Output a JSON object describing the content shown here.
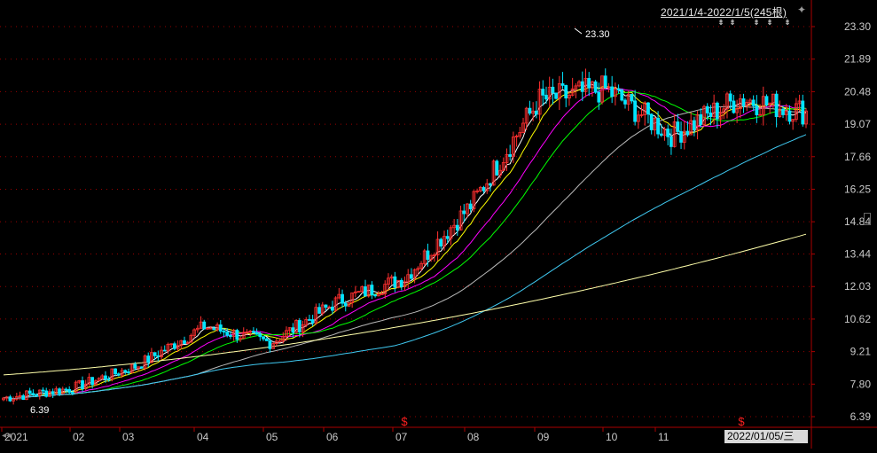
{
  "header": {
    "range_label": "2021/1/4-2022/1/5(245根)"
  },
  "footer": {
    "cursor_date": "2022/01/05/三"
  },
  "chart_data": {
    "type": "candlestick",
    "y_ticks": [
      "23.30",
      "21.89",
      "20.48",
      "19.07",
      "17.66",
      "16.25",
      "14.84",
      "13.44",
      "12.03",
      "10.62",
      "9.21",
      "7.80",
      "6.39"
    ],
    "ylim": [
      6.39,
      23.3
    ],
    "x_ticks": [
      "2021",
      "02",
      "03",
      "04",
      "05",
      "06",
      "07",
      "08",
      "09",
      "10",
      "11"
    ],
    "annotations": {
      "high": "23.30",
      "low": "6.39"
    },
    "markers": [
      "$",
      "$"
    ],
    "grid": true,
    "colors": {
      "up": "#ff3030",
      "down": "#00e5ff",
      "ma5": "#ffffff",
      "ma10": "#ffff00",
      "ma20": "#ff00ff",
      "ma30": "#00ff00",
      "ma60": "#b8b8b8",
      "ma120": "#3fc8f0",
      "ma250": "#ffffaa",
      "axis": "#aa0000",
      "label": "#c8c8c8"
    },
    "monthly_close": [
      7.2,
      7.6,
      8.6,
      10.3,
      9.6,
      11.4,
      12.4,
      15.6,
      20.1,
      20.6,
      18.6,
      20.2,
      19.6
    ],
    "ma_end": {
      "ma60": 19.1,
      "ma120": 19.1,
      "ma250": 14.3
    }
  }
}
